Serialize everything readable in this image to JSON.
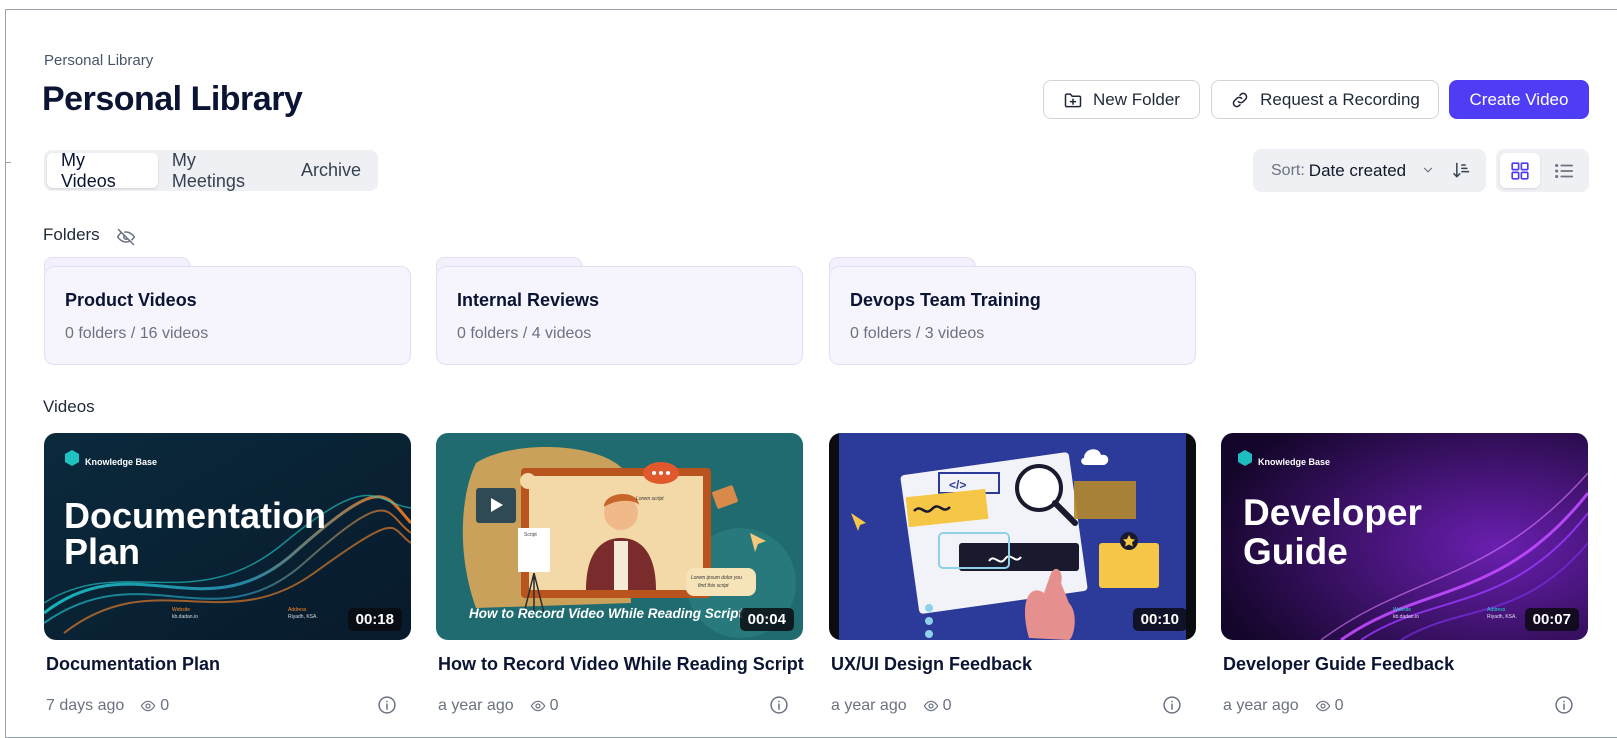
{
  "breadcrumb": "Personal Library",
  "page_title": "Personal Library",
  "actions": {
    "new_folder": "New Folder",
    "request_recording": "Request a Recording",
    "create_video": "Create Video"
  },
  "tabs": [
    {
      "label": "My Videos",
      "active": true
    },
    {
      "label": "My Meetings",
      "active": false
    },
    {
      "label": "Archive",
      "active": false
    }
  ],
  "sort": {
    "label": "Sort:",
    "value": "Date created"
  },
  "view": {
    "active": "grid"
  },
  "colors": {
    "accent": "#4f3df5",
    "folder_bg": "#f6f4fc"
  },
  "folders_section": {
    "title": "Folders"
  },
  "folders": [
    {
      "name": "Product Videos",
      "meta": "0 folders / 16 videos"
    },
    {
      "name": "Internal Reviews",
      "meta": "0 folders / 4 videos"
    },
    {
      "name": "Devops Team Training",
      "meta": "0 folders / 3 videos"
    }
  ],
  "videos_section": {
    "title": "Videos"
  },
  "videos": [
    {
      "title": "Documentation Plan",
      "duration": "00:18",
      "age": "7 days ago",
      "views": "0",
      "thumb": {
        "brand": "Knowledge Base",
        "line1": "Documentation",
        "line2": "Plan",
        "label_a": "Website",
        "value_a": "kb.dadan.io",
        "label_b": "Address",
        "value_b": "Riyadh, KSA."
      }
    },
    {
      "title": "How to Record Video While Reading Script",
      "duration": "00:04",
      "age": "a year ago",
      "views": "0",
      "thumb": {
        "caption": "How to Record Video While Reading Script",
        "note1": "Lorem ipsum dolor you",
        "note2": "find this script",
        "note3": "Lorem script",
        "paper": "Script"
      }
    },
    {
      "title": "UX/UI Design Feedback",
      "duration": "00:10",
      "age": "a year ago",
      "views": "0",
      "thumb": {
        "code": "</>"
      }
    },
    {
      "title": "Developer Guide Feedback",
      "duration": "00:07",
      "age": "a year ago",
      "views": "0",
      "thumb": {
        "brand": "Knowledge Base",
        "line1": "Developer",
        "line2": "Guide",
        "label_a": "Website",
        "value_a": "kb.dadan.io",
        "label_b": "Address",
        "value_b": "Riyadh, KSA."
      }
    }
  ]
}
